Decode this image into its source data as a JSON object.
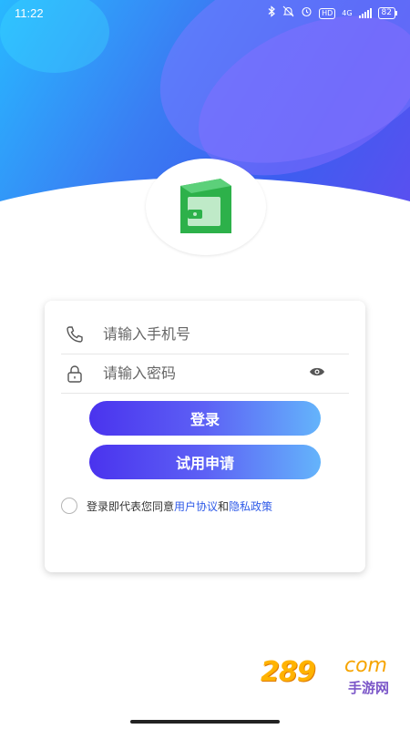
{
  "status_bar": {
    "time": "11:22",
    "network": "4G",
    "hd": "HD",
    "battery": "82"
  },
  "login_form": {
    "phone": {
      "placeholder": "请输入手机号",
      "value": ""
    },
    "password": {
      "placeholder": "请输入密码",
      "value": ""
    },
    "login_button": "登录",
    "trial_button": "试用申请"
  },
  "agreement": {
    "prefix": "登录即代表您同意",
    "user_agreement": "用户协议",
    "conjunction": "和",
    "privacy_policy": "隐私政策",
    "checked": false
  },
  "watermark": {
    "number": "289",
    "domain": "com",
    "chinese": "手游网"
  },
  "colors": {
    "brand_green": "#2db14a",
    "link_blue": "#2f5be8",
    "button_gradient_start": "#4a33ee",
    "button_gradient_end": "#64b4fb"
  },
  "icons": [
    "bluetooth-icon",
    "mute-icon",
    "alarm-icon",
    "signal-icon",
    "battery-icon",
    "phone-icon",
    "lock-icon",
    "eye-icon",
    "wallet-logo-icon"
  ]
}
